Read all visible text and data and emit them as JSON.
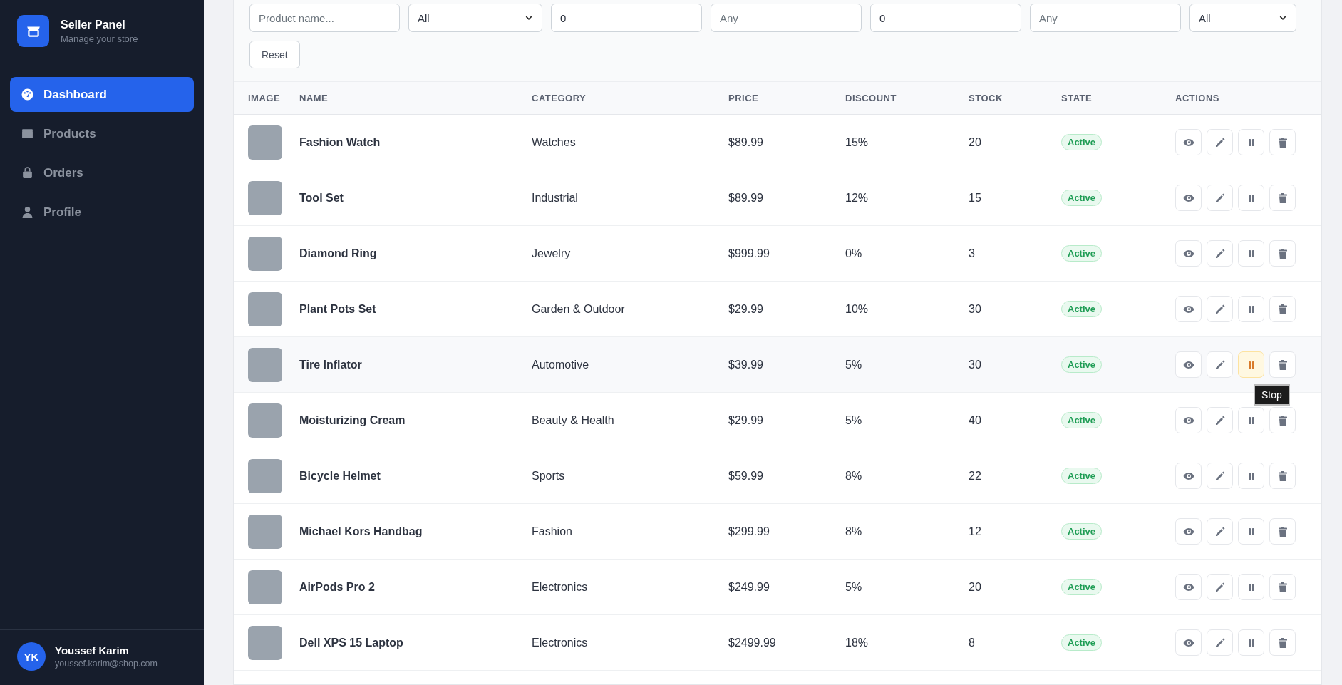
{
  "sidebar": {
    "brand": {
      "title": "Seller Panel",
      "subtitle": "Manage your store"
    },
    "items": [
      {
        "label": "Dashboard",
        "selected": true
      },
      {
        "label": "Products",
        "selected": false
      },
      {
        "label": "Orders",
        "selected": false
      },
      {
        "label": "Profile",
        "selected": false
      }
    ],
    "user": {
      "initials": "YK",
      "name": "Youssef Karim",
      "email": "youssef.karim@shop.com"
    }
  },
  "filters": [
    {
      "kind": "text",
      "placeholder": "Product name..."
    },
    {
      "kind": "select",
      "value": "All"
    },
    {
      "kind": "text",
      "value": "0"
    },
    {
      "kind": "text",
      "placeholder": "Any"
    },
    {
      "kind": "text",
      "value": "0"
    },
    {
      "kind": "text",
      "placeholder": "Any"
    },
    {
      "kind": "select",
      "value": "All"
    }
  ],
  "reset_button": "Reset",
  "table": {
    "columns": [
      "IMAGE",
      "NAME",
      "CATEGORY",
      "PRICE",
      "DISCOUNT",
      "STOCK",
      "STATE",
      "ACTIONS"
    ],
    "rows": [
      {
        "name": "Fashion Watch",
        "category": "Watches",
        "price": "$89.99",
        "discount": "15%",
        "stock": "20",
        "state": "Active",
        "hovered": false
      },
      {
        "name": "Tool Set",
        "category": "Industrial",
        "price": "$89.99",
        "discount": "12%",
        "stock": "15",
        "state": "Active",
        "hovered": false
      },
      {
        "name": "Diamond Ring",
        "category": "Jewelry",
        "price": "$999.99",
        "discount": "0%",
        "stock": "3",
        "state": "Active",
        "hovered": false
      },
      {
        "name": "Plant Pots Set",
        "category": "Garden & Outdoor",
        "price": "$29.99",
        "discount": "10%",
        "stock": "30",
        "state": "Active",
        "hovered": false
      },
      {
        "name": "Tire Inflator",
        "category": "Automotive",
        "price": "$39.99",
        "discount": "5%",
        "stock": "30",
        "state": "Active",
        "hovered": true,
        "tooltip": "Stop"
      },
      {
        "name": "Moisturizing Cream",
        "category": "Beauty & Health",
        "price": "$29.99",
        "discount": "5%",
        "stock": "40",
        "state": "Active",
        "hovered": false
      },
      {
        "name": "Bicycle Helmet",
        "category": "Sports",
        "price": "$59.99",
        "discount": "8%",
        "stock": "22",
        "state": "Active",
        "hovered": false
      },
      {
        "name": "Michael Kors Handbag",
        "category": "Fashion",
        "price": "$299.99",
        "discount": "8%",
        "stock": "12",
        "state": "Active",
        "hovered": false
      },
      {
        "name": "AirPods Pro 2",
        "category": "Electronics",
        "price": "$249.99",
        "discount": "5%",
        "stock": "20",
        "state": "Active",
        "hovered": false
      },
      {
        "name": "Dell XPS 15 Laptop",
        "category": "Electronics",
        "price": "$2499.99",
        "discount": "18%",
        "stock": "8",
        "state": "Active",
        "hovered": false
      }
    ]
  }
}
